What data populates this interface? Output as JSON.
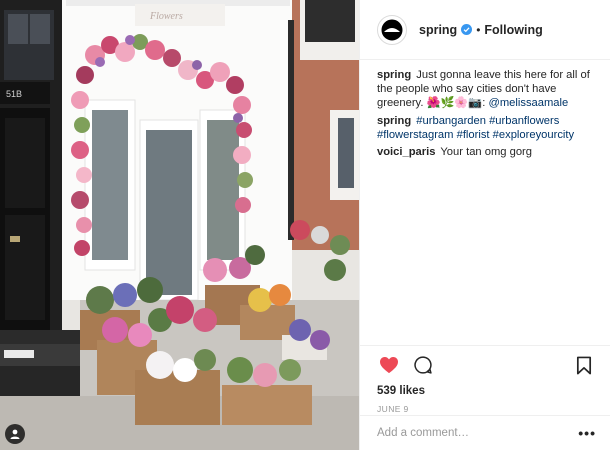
{
  "photo": {
    "description_icons": {
      "tag": "user-tag-icon"
    },
    "door_number": "51B",
    "sign_text": "Flowers"
  },
  "header": {
    "username": "spring",
    "separator": "•",
    "follow_label": "Following",
    "avatar_icon": "spring-logo-icon",
    "verified_icon": "verified-badge-icon"
  },
  "comments": [
    {
      "user": "spring",
      "text": "Just gonna leave this here for all of the people who say cities don't have greenery. 🌺🌿🌸📷:",
      "mention": "@melissaamale"
    },
    {
      "user": "spring",
      "tags": [
        "#urbangarden",
        "#urbanflowers",
        "#flowerstagram",
        "#florist",
        "#exploreyourcity"
      ]
    },
    {
      "user": "voici_paris",
      "text": "Your tan omg gorg"
    }
  ],
  "actions": {
    "like_icon": "heart-filled-icon",
    "comment_icon": "comment-bubble-icon",
    "save_icon": "bookmark-icon",
    "like_color": "#ed4956"
  },
  "likes": "539 likes",
  "date": "JUNE 9",
  "add_comment": {
    "placeholder": "Add a comment…",
    "more": "•••"
  }
}
